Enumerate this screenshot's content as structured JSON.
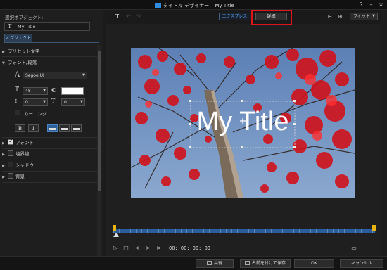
{
  "window": {
    "app_title": "タイトル デザイナー",
    "separator": "|",
    "doc_title": "My Title",
    "help_label": "?",
    "minimize_label": "–",
    "close_label": "×"
  },
  "left_panel": {
    "selected_object_label": "選択オブジェクト:",
    "selected_object_value": "My Title",
    "tab_object": "オブジェクト",
    "sections": {
      "preset_text": "プリセット文字",
      "font_paragraph": "フォント/段落",
      "font": "フォント",
      "border": "境界線",
      "shadow": "シャドウ",
      "background": "背景"
    },
    "font_name": "Segoe UI",
    "font_size": "48",
    "line_spacing": "0",
    "char_spacing": "0",
    "kerning_label": "カーニング",
    "bold_label": "B",
    "italic_label": "I",
    "font_color": "#ffffff",
    "font_checked": true,
    "border_checked": false,
    "shadow_checked": false,
    "background_checked": false,
    "kerning_checked": false
  },
  "toolbar": {
    "express_label": "エクスプレス",
    "detail_label": "詳細",
    "fit_label": "フィット",
    "highlight_color": "#e0151b",
    "accent_color": "#4da3ff"
  },
  "preview": {
    "title_text": "My Title"
  },
  "playback": {
    "timecode": "00; 00; 00; 00"
  },
  "bottom": {
    "share_label": "共有",
    "save_as_label": "名前を付けて保存",
    "ok_label": "OK",
    "cancel_label": "キャンセル"
  }
}
